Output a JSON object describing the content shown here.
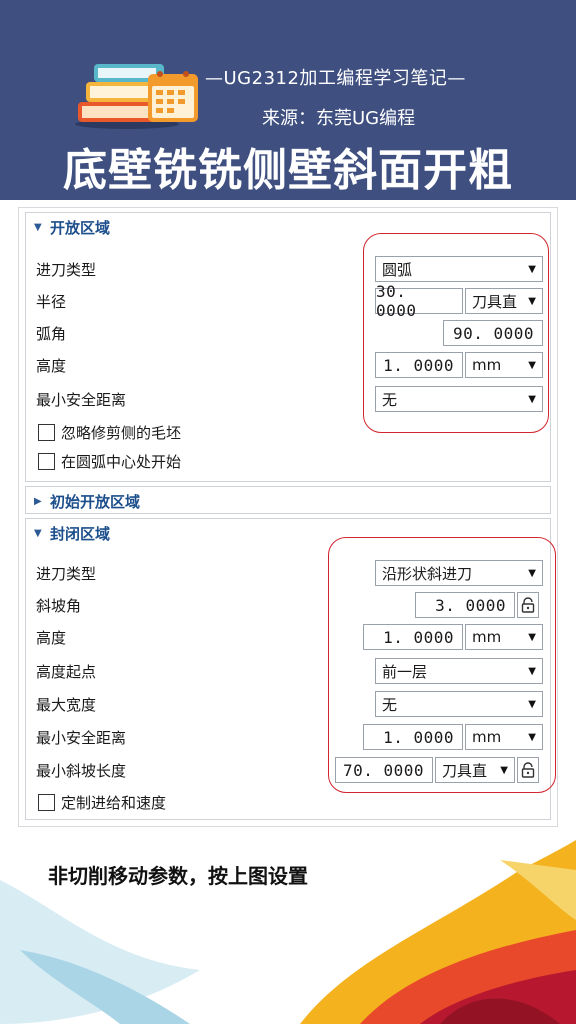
{
  "header": {
    "subtitle": "—UG2312加工编程学习笔记—",
    "source": "来源：东莞UG编程",
    "title": "底壁铣铣侧壁斜面开粗"
  },
  "colors": {
    "banner": "#3e4f80",
    "section_header": "#1d4f8c",
    "highlight_outline": "#d1242e"
  },
  "open_area": {
    "title": "开放区域",
    "expanded": true,
    "entry_type": {
      "label": "进刀类型",
      "value": "圆弧"
    },
    "radius": {
      "label": "半径",
      "value": "30. 0000",
      "unit": "刀具直"
    },
    "arc_angle": {
      "label": "弧角",
      "value": "90. 0000"
    },
    "height": {
      "label": "高度",
      "value": "1. 0000",
      "unit": "mm"
    },
    "min_clearance": {
      "label": "最小安全距离",
      "value": "无"
    },
    "ignore_trimmed_blank": {
      "label": "忽略修剪侧的毛坯",
      "checked": false
    },
    "start_at_arc_center": {
      "label": "在圆弧中心处开始",
      "checked": false
    }
  },
  "initial_open_area": {
    "title": "初始开放区域",
    "expanded": false
  },
  "closed_area": {
    "title": "封闭区域",
    "expanded": true,
    "entry_type": {
      "label": "进刀类型",
      "value": "沿形状斜进刀"
    },
    "ramp_angle": {
      "label": "斜坡角",
      "value": "3. 0000"
    },
    "height": {
      "label": "高度",
      "value": "1. 0000",
      "unit": "mm"
    },
    "height_from": {
      "label": "高度起点",
      "value": "前一层"
    },
    "max_width": {
      "label": "最大宽度",
      "value": "无"
    },
    "min_clearance": {
      "label": "最小安全距离",
      "value": "1. 0000",
      "unit": "mm"
    },
    "min_ramp_length": {
      "label": "最小斜坡长度",
      "value": "70. 0000",
      "unit": "刀具直"
    },
    "custom_feed_speed": {
      "label": "定制进给和速度",
      "checked": false
    }
  },
  "instruction": "非切削移动参数，按上图设置"
}
